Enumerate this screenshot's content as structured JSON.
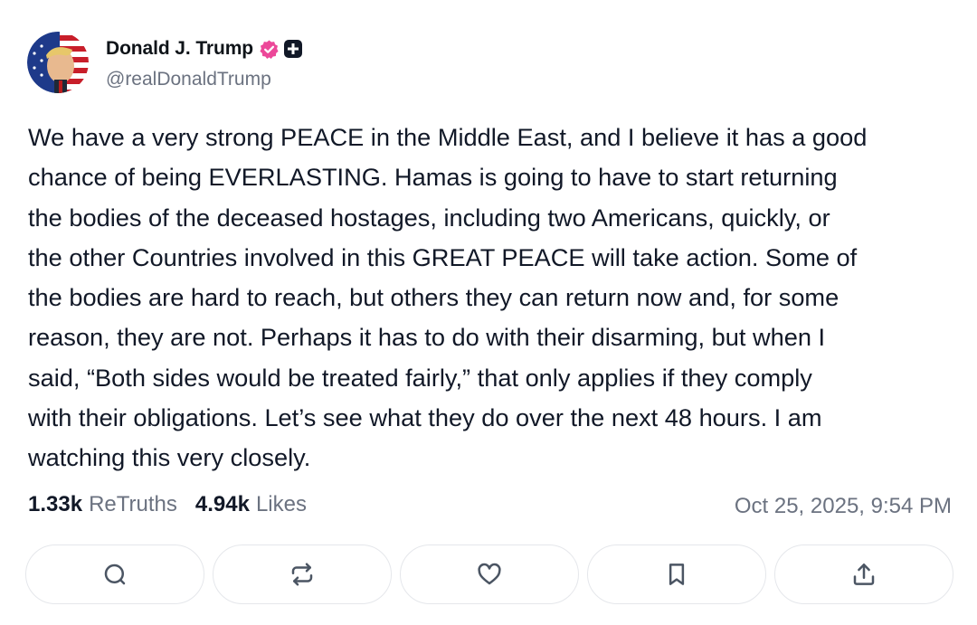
{
  "author": {
    "display_name": "Donald J. Trump",
    "handle": "@realDonaldTrump",
    "avatar_icon": "avatar-portrait",
    "verified_icon": "verified-badge-icon",
    "plus_icon": "plus-badge-icon"
  },
  "post": {
    "text": "We have a very strong PEACE in the Middle East, and I believe it has a good\nchance of being EVERLASTING. Hamas is going to have to start returning\nthe bodies of the deceased hostages, including two Americans, quickly, or\nthe other Countries involved in this GREAT PEACE will take action. Some of\nthe bodies are hard to reach, but others they can return now and, for some\nreason, they are not. Perhaps it has to do with their disarming, but when I\nsaid, “Both sides would be treated fairly,” that only applies if they comply\nwith their obligations. Let’s see what they do over the next 48 hours. I am\nwatching this very closely."
  },
  "stats": {
    "retruths_count": "1.33k",
    "retruths_label": "ReTruths",
    "likes_count": "4.94k",
    "likes_label": "Likes",
    "timestamp": "Oct 25, 2025, 9:54 PM"
  },
  "actions": [
    {
      "icon": "reply-icon"
    },
    {
      "icon": "retruth-icon"
    },
    {
      "icon": "like-icon"
    },
    {
      "icon": "bookmark-icon"
    },
    {
      "icon": "share-icon"
    }
  ],
  "colors": {
    "verified_badge": "#ec4899",
    "text_primary": "#111827",
    "text_secondary": "#6b7280",
    "border": "#e5e7eb",
    "icon": "#4b5563"
  }
}
